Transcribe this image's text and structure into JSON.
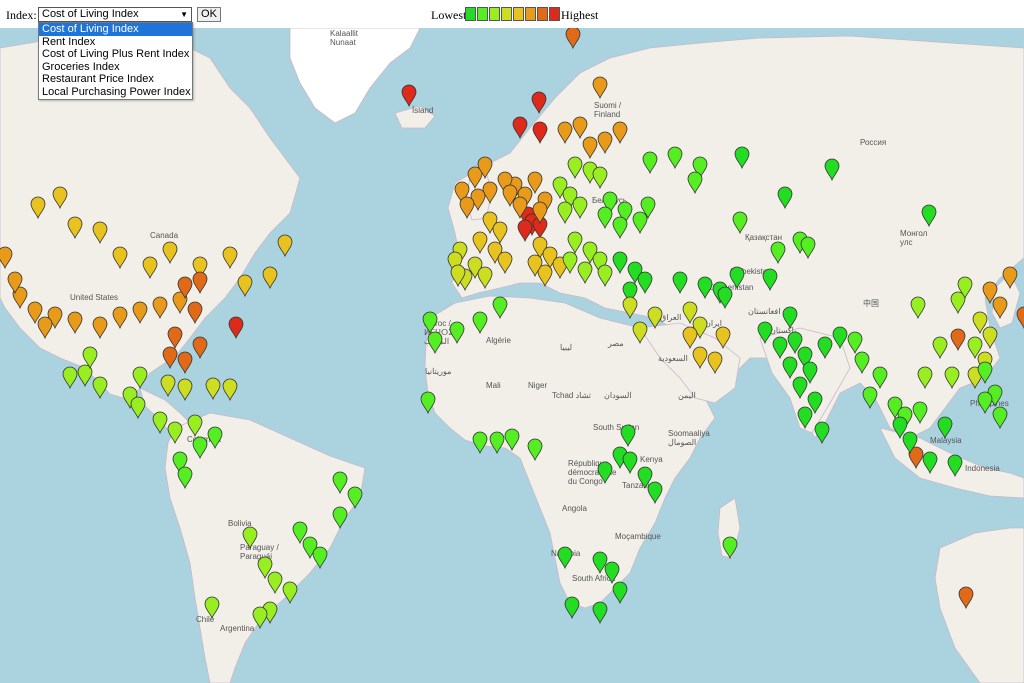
{
  "controls": {
    "index_label": "Index:",
    "selected_index": "Cost of Living Index",
    "ok_label": "OK",
    "dropdown_options": [
      "Cost of Living Index",
      "Rent Index",
      "Cost of Living Plus Rent Index",
      "Groceries Index",
      "Restaurant Price Index",
      "Local Purchasing Power Index"
    ]
  },
  "legend": {
    "low_label": "Lowest",
    "high_label": "Highest",
    "colors": [
      "#22dd22",
      "#55ee22",
      "#99ee22",
      "#ccdd22",
      "#e8c21e",
      "#e89a1a",
      "#e06a18",
      "#dd2a1a"
    ]
  },
  "map": {
    "colors": {
      "water": "#aad3df",
      "land": "#f2efe9",
      "border": "#c8b8c8",
      "ice": "#ffffff"
    },
    "labels": {
      "greenland": "Kalaallit\nNunaat",
      "iceland": "Ísland",
      "finland": "Suomi /\nFinland",
      "russia": "Россия",
      "belarus": "Беларусь",
      "kazakhstan": "Қазақстан",
      "mongolia": "Монгол\nулс",
      "uzbekistan": "Oʻzbekiston",
      "turkmenistan": "Türkmenistan",
      "china": "中国",
      "afghanistan": "افغانستان",
      "pakistan": "پاکستان",
      "iran": "ایران",
      "iraq": "العراق",
      "saudi": "السعودية",
      "yemen": "اليمن",
      "canada": "Canada",
      "usa": "United States",
      "morocco": "Maroc /\nⵍⵎⵖⵔⵉⴱ\nالمغرب",
      "algeria": "Algérie",
      "libya": "ليبيا",
      "egypt": "مصر",
      "mauritania": "موريتانيا",
      "mali": "Mali",
      "niger": "Niger",
      "chad": "Tchad تشاد",
      "sudan": "السودان",
      "south_sudan": "South Sudan",
      "somalia": "Soomaaliya\nالصومال",
      "kenya": "Kenya",
      "drc": "République\ndémocratique\ndu Congo",
      "tanzania": "Tanzania",
      "angola": "Angola",
      "mozambique": "Moçambique",
      "namibia": "Namibia",
      "south_africa": "South Africa",
      "colombia": "Colombia",
      "bolivia": "Bolivia",
      "paraguay": "Paraguay /\nParaguái",
      "chile": "Chile",
      "argentina": "Argentina",
      "malaysia": "Malaysia",
      "indonesia": "Indonesia",
      "philippines": "Philippines"
    },
    "markers": [
      {
        "region": "iceland",
        "level": 8
      },
      {
        "region": "norway-north",
        "level": 7
      },
      {
        "region": "norway",
        "level": 8
      },
      {
        "region": "sweden",
        "level": 6
      },
      {
        "region": "finland",
        "level": 6
      },
      {
        "region": "uk",
        "level": 6
      },
      {
        "region": "ireland",
        "level": 6
      },
      {
        "region": "france",
        "level": 5
      },
      {
        "region": "spain",
        "level": 4
      },
      {
        "region": "portugal",
        "level": 4
      },
      {
        "region": "switzerland",
        "level": 8
      },
      {
        "region": "germany",
        "level": 6
      },
      {
        "region": "netherlands",
        "level": 6
      },
      {
        "region": "italy",
        "level": 5
      },
      {
        "region": "poland",
        "level": 3
      },
      {
        "region": "balkans",
        "level": 3
      },
      {
        "region": "baltics",
        "level": 3
      },
      {
        "region": "ukraine",
        "level": 2
      },
      {
        "region": "turkey",
        "level": 1
      },
      {
        "region": "russia-west",
        "level": 2
      },
      {
        "region": "russia-siberia",
        "level": 1
      },
      {
        "region": "kazakhstan",
        "level": 2
      },
      {
        "region": "central-asia",
        "level": 1
      },
      {
        "region": "middle-east",
        "level": 4
      },
      {
        "region": "gulf",
        "level": 5
      },
      {
        "region": "iran",
        "level": 1
      },
      {
        "region": "pakistan",
        "level": 1
      },
      {
        "region": "india",
        "level": 1
      },
      {
        "region": "south-east-asia",
        "level": 2
      },
      {
        "region": "china",
        "level": 3
      },
      {
        "region": "korea-japan",
        "level": 4
      },
      {
        "region": "japan",
        "level": 6
      },
      {
        "region": "hong-kong-singapore",
        "level": 7
      },
      {
        "region": "philippines",
        "level": 2
      },
      {
        "region": "indonesia",
        "level": 1
      },
      {
        "region": "australia",
        "level": 7
      },
      {
        "region": "canada",
        "level": 5
      },
      {
        "region": "usa",
        "level": 6
      },
      {
        "region": "usa-east",
        "level": 7
      },
      {
        "region": "bermuda",
        "level": 8
      },
      {
        "region": "mexico",
        "level": 3
      },
      {
        "region": "caribbean",
        "level": 4
      },
      {
        "region": "central-america",
        "level": 3
      },
      {
        "region": "colombia",
        "level": 2
      },
      {
        "region": "brazil",
        "level": 2
      },
      {
        "region": "southern-cone",
        "level": 3
      },
      {
        "region": "north-africa",
        "level": 2
      },
      {
        "region": "west-africa",
        "level": 2
      },
      {
        "region": "east-africa",
        "level": 1
      },
      {
        "region": "southern-africa",
        "level": 1
      },
      {
        "region": "indian-ocean",
        "level": 2
      }
    ]
  }
}
